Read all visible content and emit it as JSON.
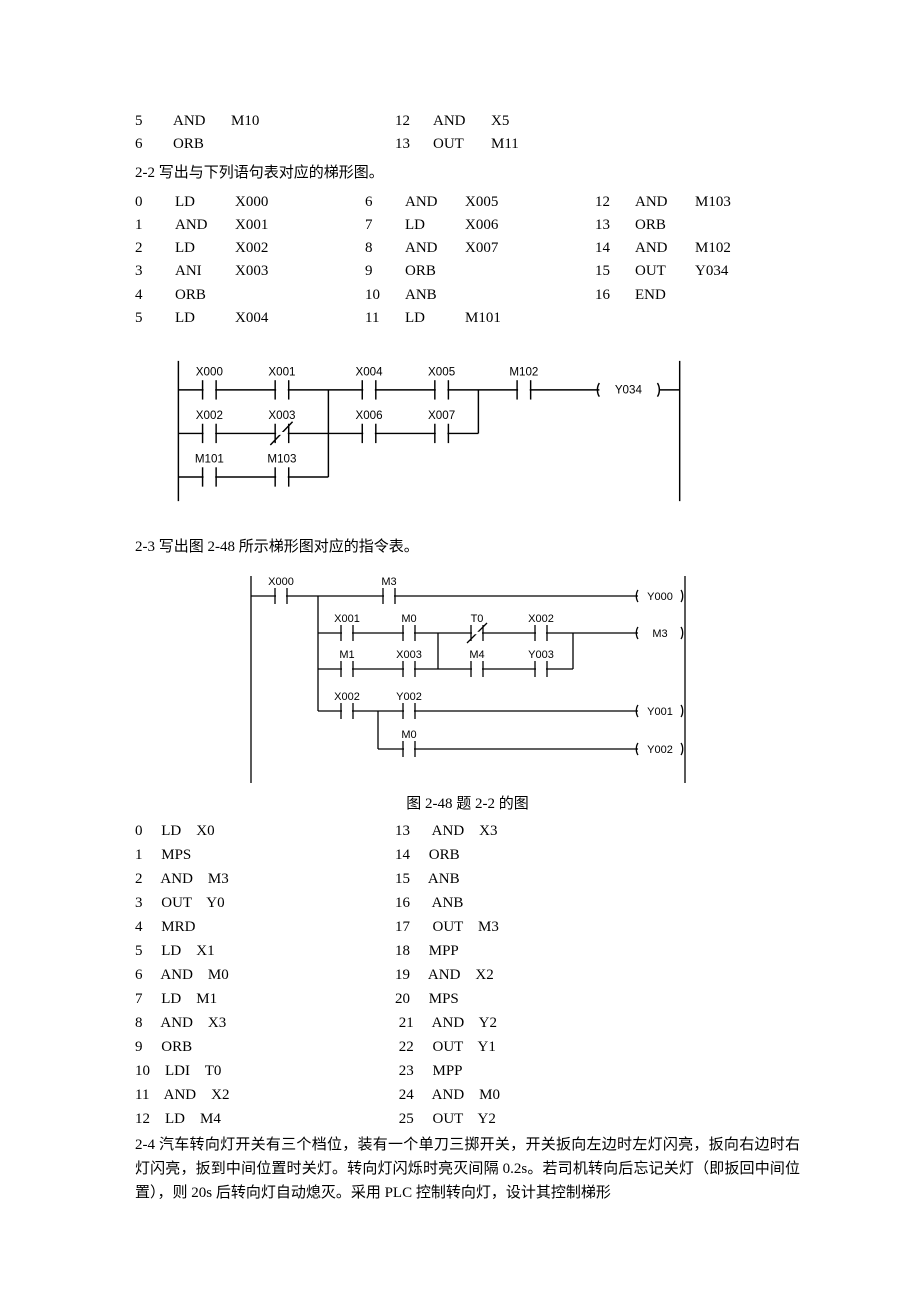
{
  "top_code": {
    "col1": [
      {
        "n": "5",
        "op": "AND",
        "arg": "M10"
      },
      {
        "n": "6",
        "op": "ORB",
        "arg": ""
      }
    ],
    "col2": [
      {
        "n": "12",
        "op": "AND",
        "arg": "X5"
      },
      {
        "n": "13",
        "op": "OUT",
        "arg": "M11"
      }
    ]
  },
  "q22": {
    "heading": "2-2   写出与下列语句表对应的梯形图。",
    "rows": [
      [
        "0",
        "LD",
        "X000",
        "6",
        "AND",
        "X005",
        "12",
        "AND",
        "M103"
      ],
      [
        "1",
        "AND",
        "X001",
        "7",
        "LD",
        "X006",
        "13",
        "ORB",
        ""
      ],
      [
        "2",
        "LD",
        "X002",
        "8",
        "AND",
        "X007",
        "14",
        "AND",
        "M102"
      ],
      [
        "3",
        "ANI",
        "X003",
        "9",
        "ORB",
        "",
        "15",
        "OUT",
        "Y034"
      ],
      [
        "4",
        "ORB",
        "",
        "10",
        "ANB",
        "",
        "16",
        "END",
        ""
      ],
      [
        "5",
        "LD",
        "X004",
        "11",
        "LD",
        "M101",
        "",
        "",
        ""
      ]
    ]
  },
  "ladder1": {
    "r1": [
      "X000",
      "X001",
      "X004",
      "X005",
      "M102"
    ],
    "r2": [
      "X002",
      "X003",
      "X006",
      "X007"
    ],
    "r3": [
      "M101",
      "M103"
    ],
    "coil": "Y034"
  },
  "q23": {
    "heading": "2-3   写出图 2-48 所示梯形图对应的指令表。",
    "caption": "图 2-48  题 2-2 的图"
  },
  "ladder2": {
    "r1": {
      "contacts": [
        "X000",
        "M3"
      ],
      "coil": "Y000"
    },
    "r2": {
      "contacts": [
        "X001",
        "M0",
        "T0",
        "X002"
      ],
      "coil": "M3",
      "nc": [
        2
      ]
    },
    "r3": {
      "contacts": [
        "M1",
        "X003",
        "M4",
        "Y003"
      ]
    },
    "r4": {
      "contacts": [
        "X002",
        "Y002"
      ],
      "coil": "Y001"
    },
    "r5": {
      "contacts": [
        "M0"
      ],
      "coil": "Y002"
    }
  },
  "answer23": {
    "col1": [
      "0     LD    X0",
      "1     MPS",
      "2     AND    M3",
      "3     OUT    Y0",
      "4     MRD",
      "5     LD    X1",
      "6     AND    M0",
      "7     LD    M1",
      "8     AND    X3",
      "9     ORB",
      "10    LDI    T0",
      "11    AND    X2",
      "12    LD    M4"
    ],
    "col2": [
      "13      AND    X3",
      "14     ORB",
      "15     ANB",
      "16      ANB",
      "17      OUT    M3",
      "18     MPP",
      "19     AND    X2",
      "20     MPS",
      " 21     AND    Y2",
      " 22     OUT    Y1",
      " 23     MPP",
      " 24     AND    M0",
      " 25     OUT    Y2"
    ]
  },
  "q24": {
    "text": "2-4 汽车转向灯开关有三个档位，装有一个单刀三掷开关，开关扳向左边时左灯闪亮，扳向右边时右灯闪亮，扳到中间位置时关灯。转向灯闪烁时亮灭间隔 0.2s。若司机转向后忘记关灯（即扳回中间位置），则 20s 后转向灯自动熄灭。采用 PLC 控制转向灯，设计其控制梯形"
  }
}
